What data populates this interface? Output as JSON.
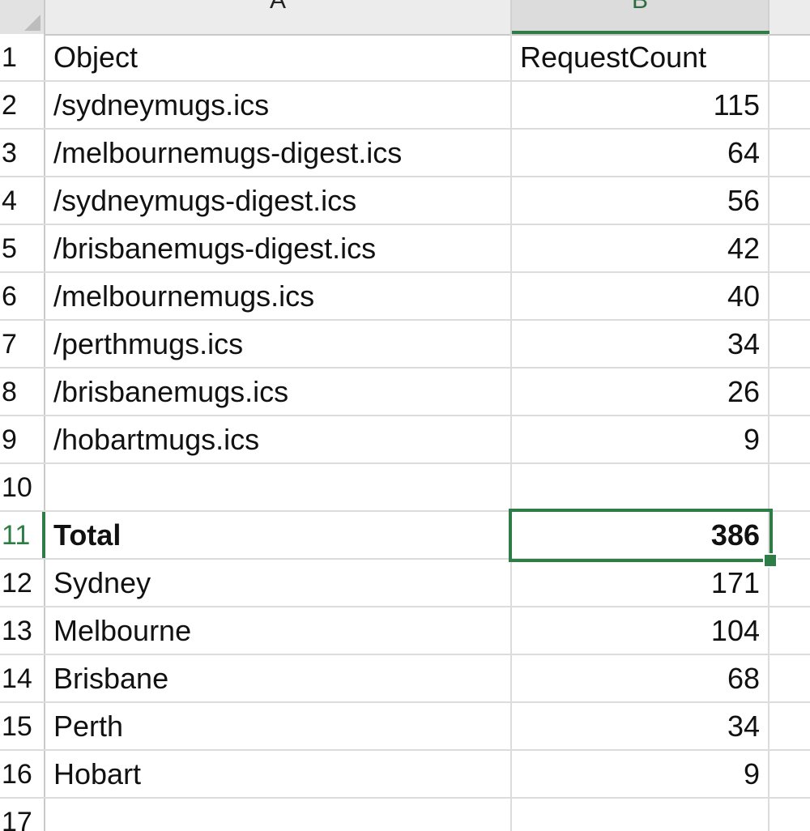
{
  "columns": {
    "a": "A",
    "b": "B"
  },
  "rows": [
    {
      "num": "1",
      "a": "Object",
      "b": "RequestCount"
    },
    {
      "num": "2",
      "a": "/sydneymugs.ics",
      "b": "115"
    },
    {
      "num": "3",
      "a": "/melbournemugs-digest.ics",
      "b": "64"
    },
    {
      "num": "4",
      "a": "/sydneymugs-digest.ics",
      "b": "56"
    },
    {
      "num": "5",
      "a": "/brisbanemugs-digest.ics",
      "b": "42"
    },
    {
      "num": "6",
      "a": "/melbournemugs.ics",
      "b": "40"
    },
    {
      "num": "7",
      "a": "/perthmugs.ics",
      "b": "34"
    },
    {
      "num": "8",
      "a": "/brisbanemugs.ics",
      "b": "26"
    },
    {
      "num": "9",
      "a": "/hobartmugs.ics",
      "b": "9"
    },
    {
      "num": "10",
      "a": "",
      "b": ""
    },
    {
      "num": "11",
      "a": "Total",
      "b": "386"
    },
    {
      "num": "12",
      "a": "Sydney",
      "b": "171"
    },
    {
      "num": "13",
      "a": "Melbourne",
      "b": "104"
    },
    {
      "num": "14",
      "a": "Brisbane",
      "b": "68"
    },
    {
      "num": "15",
      "a": "Perth",
      "b": "34"
    },
    {
      "num": "16",
      "a": "Hobart",
      "b": "9"
    },
    {
      "num": "17",
      "a": "",
      "b": ""
    }
  ],
  "selection": {
    "cell": "B11"
  },
  "colors": {
    "accent": "#2e7d46",
    "grid": "#dcdcdc",
    "header_bg": "#ececec"
  }
}
